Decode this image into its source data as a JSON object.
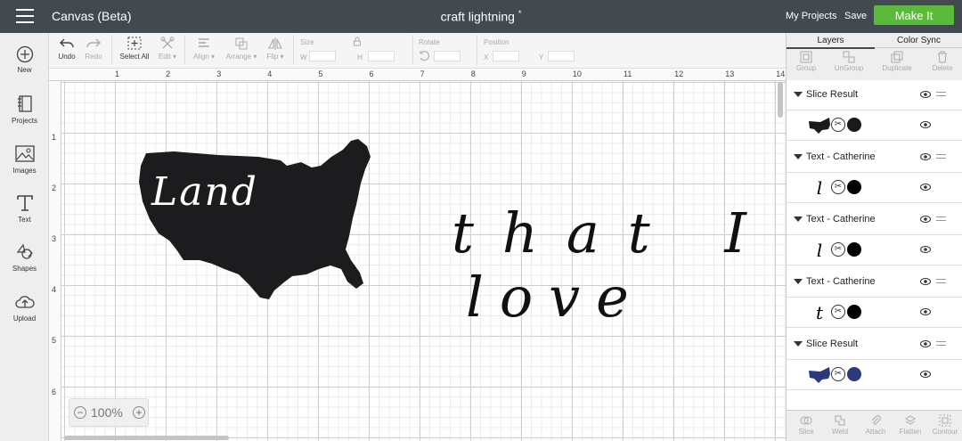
{
  "header": {
    "app_title": "Canvas (Beta)",
    "doc_title": "craft lightning",
    "doc_modified_mark": "*",
    "my_projects": "My Projects",
    "save": "Save",
    "make_it": "Make It"
  },
  "sidebar": {
    "items": [
      {
        "label": "New",
        "icon": "plus-circle-icon"
      },
      {
        "label": "Projects",
        "icon": "book-icon"
      },
      {
        "label": "Images",
        "icon": "image-icon"
      },
      {
        "label": "Text",
        "icon": "text-icon"
      },
      {
        "label": "Shapes",
        "icon": "shapes-icon"
      },
      {
        "label": "Upload",
        "icon": "cloud-upload-icon"
      }
    ]
  },
  "toolbar": {
    "undo": "Undo",
    "redo": "Redo",
    "select_all": "Select All",
    "edit": "Edit",
    "align": "Align",
    "arrange": "Arrange",
    "flip": "Flip",
    "size_label": "Size",
    "w_label": "W",
    "h_label": "H",
    "rotate_label": "Rotate",
    "position_label": "Position",
    "x_label": "X",
    "y_label": "Y"
  },
  "canvas": {
    "ruler_top": [
      "1",
      "2",
      "3",
      "4",
      "5",
      "6",
      "7",
      "8",
      "9",
      "10",
      "11",
      "12",
      "13",
      "14"
    ],
    "ruler_left": [
      "1",
      "2",
      "3",
      "4",
      "5",
      "6"
    ],
    "zoom_value": "100%",
    "zoom_minus": "−",
    "zoom_plus": "+",
    "text_land": "Land",
    "text_that": "that I",
    "text_love": "love"
  },
  "panel": {
    "tabs": [
      "Layers",
      "Color Sync"
    ],
    "actions": [
      "Group",
      "UnGroup",
      "Duplicate",
      "Delete"
    ],
    "layers": [
      {
        "name": "Slice Result",
        "child_glyph": "",
        "color": "#1a1a1a"
      },
      {
        "name": "Text - Catherine",
        "child_glyph": "l",
        "color": "#000000"
      },
      {
        "name": "Text - Catherine",
        "child_glyph": "l",
        "color": "#000000"
      },
      {
        "name": "Text - Catherine",
        "child_glyph": "t",
        "color": "#000000"
      },
      {
        "name": "Slice Result",
        "child_glyph": "",
        "color": "#2b3a7c"
      }
    ],
    "bottom_actions": [
      "Slice",
      "Weld",
      "Attach",
      "Flatten",
      "Contour"
    ]
  }
}
